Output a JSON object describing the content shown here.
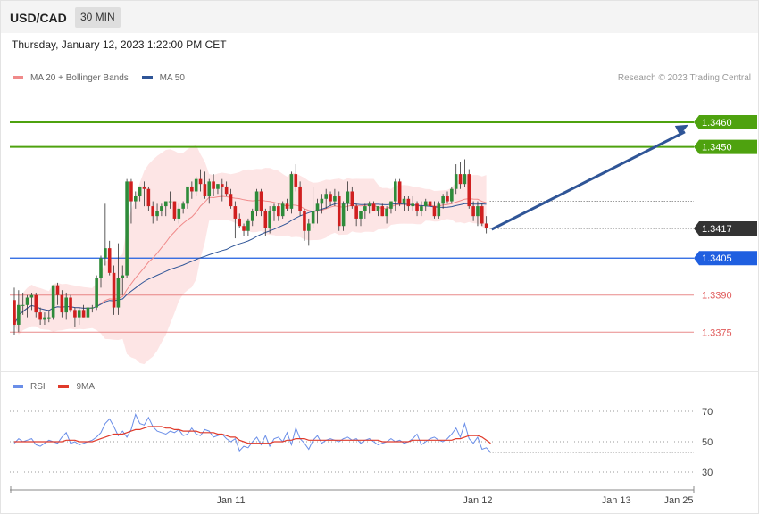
{
  "header": {
    "symbol": "USD/CAD",
    "timeframe": "30 MIN"
  },
  "date_text": "Thursday, January 12, 2023 1:22:00 PM CET",
  "credit": "Research © 2023 Trading Central",
  "colors": {
    "ma20": "#f08a8a",
    "ma50": "#2f5597",
    "band_fill": "#fde1e1",
    "up": "#2e8b3a",
    "down": "#d01f1f",
    "resistance": "#4ea20f",
    "pivot": "#1f5fe0",
    "support": "#e05a5a",
    "arrow": "#2f5597",
    "rsi": "#6a8ee8",
    "rsi_ma": "#e03a2a",
    "current_tag": "#333333"
  },
  "chart_data": [
    {
      "type": "candlestick",
      "title": "",
      "legend": [
        "MA 20 + Bollinger Bands",
        "MA 50"
      ],
      "legend_position": "top-left",
      "ylim": [
        1.3361,
        1.3473
      ],
      "x_ticks": [
        "Jan 11",
        "Jan 12",
        "Jan 13",
        "Jan 25"
      ],
      "levels": [
        {
          "value": 1.346,
          "label": "1.3460",
          "kind": "resistance"
        },
        {
          "value": 1.345,
          "label": "1.3450",
          "kind": "resistance"
        },
        {
          "value": 1.3417,
          "label": "1.3417",
          "kind": "current"
        },
        {
          "value": 1.3405,
          "label": "1.3405",
          "kind": "pivot"
        },
        {
          "value": 1.339,
          "label": "1.3390",
          "kind": "support"
        },
        {
          "value": 1.3375,
          "label": "1.3375",
          "kind": "support"
        }
      ],
      "projection": {
        "from": 1.3417,
        "to": 1.3459
      },
      "candles": [
        [
          1.3388,
          1.3393,
          1.3374,
          1.3378
        ],
        [
          1.3378,
          1.3392,
          1.3375,
          1.3386
        ],
        [
          1.3386,
          1.3391,
          1.3382,
          1.3386
        ],
        [
          1.3386,
          1.339,
          1.3381,
          1.3389
        ],
        [
          1.3389,
          1.3391,
          1.3384,
          1.339
        ],
        [
          1.339,
          1.3391,
          1.3381,
          1.3383
        ],
        [
          1.3383,
          1.3385,
          1.3378,
          1.338
        ],
        [
          1.338,
          1.3383,
          1.3378,
          1.3381
        ],
        [
          1.3381,
          1.3384,
          1.3379,
          1.3381
        ],
        [
          1.3381,
          1.3394,
          1.338,
          1.3394
        ],
        [
          1.3394,
          1.3395,
          1.3386,
          1.339
        ],
        [
          1.339,
          1.3392,
          1.3381,
          1.3383
        ],
        [
          1.3383,
          1.3391,
          1.338,
          1.3389
        ],
        [
          1.3389,
          1.339,
          1.3383,
          1.3384
        ],
        [
          1.3384,
          1.3385,
          1.3377,
          1.3381
        ],
        [
          1.3381,
          1.3385,
          1.3378,
          1.3384
        ],
        [
          1.3384,
          1.3386,
          1.3381,
          1.3381
        ],
        [
          1.3381,
          1.3386,
          1.338,
          1.3385
        ],
        [
          1.3385,
          1.3386,
          1.3383,
          1.3385
        ],
        [
          1.3385,
          1.3398,
          1.3384,
          1.3397
        ],
        [
          1.3397,
          1.3406,
          1.3393,
          1.3405
        ],
        [
          1.3405,
          1.3427,
          1.3402,
          1.3409
        ],
        [
          1.3409,
          1.3412,
          1.3398,
          1.3399
        ],
        [
          1.3399,
          1.3402,
          1.3382,
          1.3385
        ],
        [
          1.3385,
          1.3411,
          1.3382,
          1.3397
        ],
        [
          1.3397,
          1.3402,
          1.339,
          1.3398
        ],
        [
          1.3398,
          1.3437,
          1.3397,
          1.3436
        ],
        [
          1.3436,
          1.3437,
          1.3419,
          1.3428
        ],
        [
          1.3428,
          1.3432,
          1.3425,
          1.343
        ],
        [
          1.343,
          1.3434,
          1.3428,
          1.3434
        ],
        [
          1.3434,
          1.3436,
          1.3426,
          1.3433
        ],
        [
          1.3433,
          1.3434,
          1.3424,
          1.3426
        ],
        [
          1.3426,
          1.3428,
          1.3419,
          1.3422
        ],
        [
          1.3422,
          1.3427,
          1.342,
          1.3424
        ],
        [
          1.3424,
          1.3427,
          1.3422,
          1.3426
        ],
        [
          1.3426,
          1.3428,
          1.3422,
          1.3428
        ],
        [
          1.3428,
          1.3432,
          1.3425,
          1.3428
        ],
        [
          1.3428,
          1.3428,
          1.342,
          1.3421
        ],
        [
          1.3421,
          1.3427,
          1.3419,
          1.3425
        ],
        [
          1.3425,
          1.3428,
          1.3423,
          1.3427
        ],
        [
          1.3427,
          1.3434,
          1.3425,
          1.3434
        ],
        [
          1.3434,
          1.3436,
          1.3429,
          1.3432
        ],
        [
          1.3432,
          1.3438,
          1.343,
          1.3437
        ],
        [
          1.3437,
          1.3441,
          1.3432,
          1.3435
        ],
        [
          1.3435,
          1.344,
          1.3429,
          1.343
        ],
        [
          1.343,
          1.3437,
          1.3427,
          1.3436
        ],
        [
          1.3436,
          1.3439,
          1.343,
          1.3433
        ],
        [
          1.3433,
          1.3435,
          1.3431,
          1.3435
        ],
        [
          1.3435,
          1.3437,
          1.3428,
          1.3434
        ],
        [
          1.3434,
          1.3436,
          1.343,
          1.3431
        ],
        [
          1.3431,
          1.3433,
          1.3425,
          1.3426
        ],
        [
          1.3426,
          1.3428,
          1.3413,
          1.3421
        ],
        [
          1.3421,
          1.3423,
          1.3417,
          1.3418
        ],
        [
          1.3418,
          1.3419,
          1.3414,
          1.3416
        ],
        [
          1.3416,
          1.3421,
          1.3414,
          1.342
        ],
        [
          1.342,
          1.3425,
          1.3418,
          1.3424
        ],
        [
          1.3424,
          1.3433,
          1.3422,
          1.3432
        ],
        [
          1.3432,
          1.3433,
          1.3422,
          1.3424
        ],
        [
          1.3424,
          1.3425,
          1.3414,
          1.3417
        ],
        [
          1.3417,
          1.3426,
          1.3415,
          1.3424
        ],
        [
          1.3424,
          1.3427,
          1.342,
          1.3426
        ],
        [
          1.3426,
          1.3427,
          1.342,
          1.3422
        ],
        [
          1.3422,
          1.3428,
          1.3421,
          1.3427
        ],
        [
          1.3427,
          1.3429,
          1.3424,
          1.3425
        ],
        [
          1.3425,
          1.344,
          1.3423,
          1.3439
        ],
        [
          1.3439,
          1.3443,
          1.3432,
          1.3434
        ],
        [
          1.3434,
          1.3436,
          1.3422,
          1.3424
        ],
        [
          1.3424,
          1.3425,
          1.3412,
          1.3416
        ],
        [
          1.3416,
          1.3421,
          1.341,
          1.3419
        ],
        [
          1.3419,
          1.3434,
          1.3417,
          1.3424
        ],
        [
          1.3424,
          1.3429,
          1.3419,
          1.3427
        ],
        [
          1.3427,
          1.3431,
          1.3423,
          1.3429
        ],
        [
          1.3429,
          1.3433,
          1.3425,
          1.3431
        ],
        [
          1.3431,
          1.3432,
          1.3426,
          1.3428
        ],
        [
          1.3428,
          1.3433,
          1.3426,
          1.343
        ],
        [
          1.343,
          1.3432,
          1.3416,
          1.3418
        ],
        [
          1.3418,
          1.3428,
          1.3416,
          1.3427
        ],
        [
          1.3427,
          1.3436,
          1.3424,
          1.3432
        ],
        [
          1.3432,
          1.3434,
          1.3425,
          1.3426
        ],
        [
          1.3426,
          1.3427,
          1.3418,
          1.3421
        ],
        [
          1.3421,
          1.3424,
          1.3418,
          1.3424
        ],
        [
          1.3424,
          1.3427,
          1.3421,
          1.3426
        ],
        [
          1.3426,
          1.3428,
          1.3423,
          1.3427
        ],
        [
          1.3427,
          1.3428,
          1.3424,
          1.3424
        ],
        [
          1.3424,
          1.3426,
          1.3422,
          1.3426
        ],
        [
          1.3426,
          1.3427,
          1.3422,
          1.3422
        ],
        [
          1.3422,
          1.3426,
          1.3419,
          1.3425
        ],
        [
          1.3425,
          1.3428,
          1.3423,
          1.3428
        ],
        [
          1.3428,
          1.3437,
          1.3424,
          1.3436
        ],
        [
          1.3436,
          1.3437,
          1.3426,
          1.3427
        ],
        [
          1.3427,
          1.343,
          1.3424,
          1.3429
        ],
        [
          1.3429,
          1.343,
          1.3424,
          1.3426
        ],
        [
          1.3426,
          1.343,
          1.3424,
          1.3427
        ],
        [
          1.3427,
          1.3428,
          1.3422,
          1.3424
        ],
        [
          1.3424,
          1.3428,
          1.3422,
          1.3426
        ],
        [
          1.3426,
          1.3429,
          1.3424,
          1.3428
        ],
        [
          1.3428,
          1.343,
          1.3424,
          1.3426
        ],
        [
          1.3426,
          1.3428,
          1.3421,
          1.3422
        ],
        [
          1.3422,
          1.3428,
          1.3421,
          1.3427
        ],
        [
          1.3427,
          1.3431,
          1.3425,
          1.343
        ],
        [
          1.343,
          1.3432,
          1.3427,
          1.3428
        ],
        [
          1.3428,
          1.3434,
          1.3427,
          1.3433
        ],
        [
          1.3433,
          1.3443,
          1.3431,
          1.3439
        ],
        [
          1.3439,
          1.3444,
          1.3433,
          1.3435
        ],
        [
          1.3435,
          1.3445,
          1.3434,
          1.3439
        ],
        [
          1.3439,
          1.3441,
          1.3425,
          1.3426
        ],
        [
          1.3426,
          1.3428,
          1.342,
          1.3422
        ],
        [
          1.3422,
          1.3428,
          1.3418,
          1.3426
        ],
        [
          1.3426,
          1.3427,
          1.3418,
          1.3419
        ],
        [
          1.3419,
          1.3422,
          1.3415,
          1.3417
        ]
      ]
    },
    {
      "type": "line",
      "title": "",
      "legend": [
        "RSI",
        "9MA"
      ],
      "legend_position": "top-left",
      "ylim": [
        20,
        80
      ],
      "y_ticks": [
        70,
        50,
        30
      ],
      "series": [
        {
          "name": "RSI",
          "values": [
            49,
            52,
            50,
            51,
            52,
            48,
            47,
            49,
            51,
            50,
            49,
            53,
            56,
            49,
            50,
            48,
            49,
            50,
            51,
            53,
            56,
            62,
            65,
            60,
            54,
            57,
            53,
            58,
            68,
            62,
            61,
            66,
            60,
            57,
            56,
            55,
            57,
            56,
            58,
            54,
            55,
            59,
            55,
            54,
            58,
            57,
            53,
            54,
            55,
            52,
            50,
            52,
            44,
            47,
            46,
            50,
            53,
            48,
            54,
            47,
            52,
            53,
            50,
            56,
            48,
            59,
            52,
            49,
            45,
            51,
            54,
            49,
            51,
            52,
            51,
            50,
            52,
            53,
            51,
            52,
            49,
            51,
            52,
            50,
            48,
            49,
            50,
            52,
            50,
            51,
            49,
            50,
            52,
            55,
            48,
            50,
            52,
            53,
            51,
            50,
            52,
            55,
            59,
            53,
            62,
            52,
            49,
            53,
            45,
            46,
            43
          ]
        },
        {
          "name": "9MA",
          "values": [
            50,
            50,
            50,
            50,
            50,
            50,
            50,
            50,
            50,
            50,
            50,
            50,
            51,
            51,
            51,
            50,
            50,
            50,
            50,
            51,
            52,
            53,
            54,
            55,
            55,
            55,
            56,
            57,
            58,
            58,
            59,
            60,
            60,
            60,
            60,
            59,
            59,
            58,
            58,
            57,
            57,
            57,
            57,
            56,
            56,
            56,
            56,
            55,
            55,
            54,
            53,
            53,
            51,
            50,
            49,
            49,
            49,
            49,
            49,
            49,
            50,
            50,
            50,
            51,
            51,
            52,
            52,
            52,
            51,
            51,
            51,
            51,
            51,
            51,
            51,
            51,
            51,
            51,
            51,
            51,
            51,
            51,
            51,
            51,
            51,
            50,
            50,
            50,
            50,
            50,
            50,
            50,
            51,
            51,
            51,
            51,
            51,
            51,
            51,
            51,
            51,
            51,
            52,
            52,
            53,
            54,
            54,
            54,
            53,
            51,
            49
          ]
        }
      ]
    }
  ]
}
